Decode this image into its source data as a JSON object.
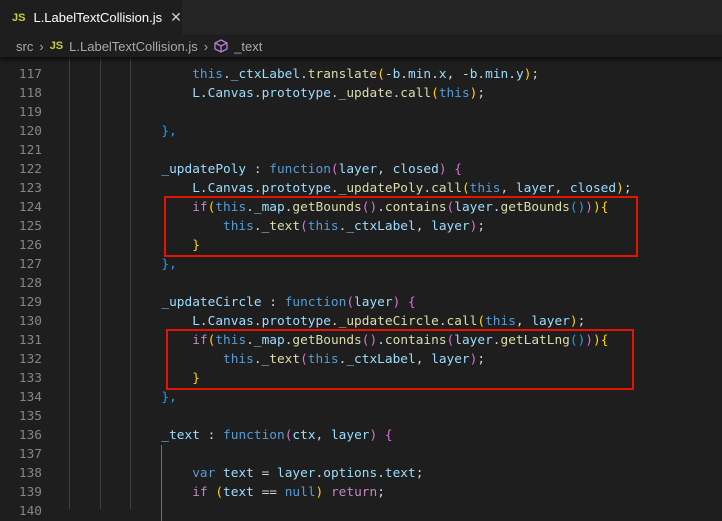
{
  "tab": {
    "icon": "JS",
    "title": "L.LabelTextCollision.js",
    "close": "✕"
  },
  "breadcrumb": {
    "folder": "src",
    "file_icon": "JS",
    "file": "L.LabelTextCollision.js",
    "symbol": "_text"
  },
  "lines": [
    {
      "n": "117",
      "indent": 16,
      "t": [
        [
          "this",
          "k"
        ],
        [
          ".",
          "p"
        ],
        [
          "_ctxLabel",
          "v"
        ],
        [
          ".",
          "p"
        ],
        [
          "translate",
          "f"
        ],
        [
          "(",
          "b1"
        ],
        [
          "-",
          "p"
        ],
        [
          "b",
          "v"
        ],
        [
          ".",
          "p"
        ],
        [
          "min",
          "v"
        ],
        [
          ".",
          "p"
        ],
        [
          "x",
          "v"
        ],
        [
          ", -",
          "p"
        ],
        [
          "b",
          "v"
        ],
        [
          ".",
          "p"
        ],
        [
          "min",
          "v"
        ],
        [
          ".",
          "p"
        ],
        [
          "y",
          "v"
        ],
        [
          ")",
          "b1"
        ],
        [
          ";",
          "p"
        ]
      ]
    },
    {
      "n": "118",
      "indent": 16,
      "t": [
        [
          "L",
          "v"
        ],
        [
          ".",
          "p"
        ],
        [
          "Canvas",
          "v"
        ],
        [
          ".",
          "p"
        ],
        [
          "prototype",
          "v"
        ],
        [
          ".",
          "p"
        ],
        [
          "_update",
          "f"
        ],
        [
          ".",
          "p"
        ],
        [
          "call",
          "f"
        ],
        [
          "(",
          "b1"
        ],
        [
          "this",
          "k"
        ],
        [
          ")",
          "b1"
        ],
        [
          ";",
          "p"
        ]
      ]
    },
    {
      "n": "119",
      "indent": 0,
      "t": []
    },
    {
      "n": "120",
      "indent": 12,
      "t": [
        [
          "},",
          "b3"
        ]
      ]
    },
    {
      "n": "121",
      "indent": 0,
      "t": []
    },
    {
      "n": "122",
      "indent": 12,
      "t": [
        [
          "_updatePoly",
          "v"
        ],
        [
          " : ",
          "p"
        ],
        [
          "function",
          "k"
        ],
        [
          "(",
          "b2"
        ],
        [
          "layer",
          "v"
        ],
        [
          ", ",
          "p"
        ],
        [
          "closed",
          "v"
        ],
        [
          ") ",
          "b2"
        ],
        [
          "{",
          "b2"
        ]
      ]
    },
    {
      "n": "123",
      "indent": 16,
      "t": [
        [
          "L",
          "v"
        ],
        [
          ".",
          "p"
        ],
        [
          "Canvas",
          "v"
        ],
        [
          ".",
          "p"
        ],
        [
          "prototype",
          "v"
        ],
        [
          ".",
          "p"
        ],
        [
          "_updatePoly",
          "f"
        ],
        [
          ".",
          "p"
        ],
        [
          "call",
          "f"
        ],
        [
          "(",
          "b1"
        ],
        [
          "this",
          "k"
        ],
        [
          ", ",
          "p"
        ],
        [
          "layer",
          "v"
        ],
        [
          ", ",
          "p"
        ],
        [
          "closed",
          "v"
        ],
        [
          ")",
          "b1"
        ],
        [
          ";",
          "p"
        ]
      ]
    },
    {
      "n": "124",
      "indent": 16,
      "t": [
        [
          "if",
          "c"
        ],
        [
          "(",
          "b1"
        ],
        [
          "this",
          "k"
        ],
        [
          ".",
          "p"
        ],
        [
          "_map",
          "v"
        ],
        [
          ".",
          "p"
        ],
        [
          "getBounds",
          "f"
        ],
        [
          "()",
          "b2"
        ],
        [
          ".",
          "p"
        ],
        [
          "contains",
          "f"
        ],
        [
          "(",
          "b2"
        ],
        [
          "layer",
          "v"
        ],
        [
          ".",
          "p"
        ],
        [
          "getBounds",
          "f"
        ],
        [
          "()",
          "b3"
        ],
        [
          ")",
          "b2"
        ],
        [
          ")",
          "b1"
        ],
        [
          "{",
          "b1"
        ]
      ]
    },
    {
      "n": "125",
      "indent": 20,
      "t": [
        [
          "this",
          "k"
        ],
        [
          ".",
          "p"
        ],
        [
          "_text",
          "f"
        ],
        [
          "(",
          "b2"
        ],
        [
          "this",
          "k"
        ],
        [
          ".",
          "p"
        ],
        [
          "_ctxLabel",
          "v"
        ],
        [
          ", ",
          "p"
        ],
        [
          "layer",
          "v"
        ],
        [
          ")",
          "b2"
        ],
        [
          ";",
          "p"
        ]
      ]
    },
    {
      "n": "126",
      "indent": 16,
      "t": [
        [
          "}",
          "b1"
        ]
      ]
    },
    {
      "n": "127",
      "indent": 12,
      "t": [
        [
          "},",
          "b3"
        ]
      ]
    },
    {
      "n": "128",
      "indent": 0,
      "t": []
    },
    {
      "n": "129",
      "indent": 12,
      "t": [
        [
          "_updateCircle",
          "v"
        ],
        [
          " : ",
          "p"
        ],
        [
          "function",
          "k"
        ],
        [
          "(",
          "b2"
        ],
        [
          "layer",
          "v"
        ],
        [
          ") ",
          "b2"
        ],
        [
          "{",
          "b2"
        ]
      ]
    },
    {
      "n": "130",
      "indent": 16,
      "t": [
        [
          "L",
          "v"
        ],
        [
          ".",
          "p"
        ],
        [
          "Canvas",
          "v"
        ],
        [
          ".",
          "p"
        ],
        [
          "prototype",
          "v"
        ],
        [
          ".",
          "p"
        ],
        [
          "_updateCircle",
          "f"
        ],
        [
          ".",
          "p"
        ],
        [
          "call",
          "f"
        ],
        [
          "(",
          "b1"
        ],
        [
          "this",
          "k"
        ],
        [
          ", ",
          "p"
        ],
        [
          "layer",
          "v"
        ],
        [
          ")",
          "b1"
        ],
        [
          ";",
          "p"
        ]
      ]
    },
    {
      "n": "131",
      "indent": 16,
      "t": [
        [
          "if",
          "c"
        ],
        [
          "(",
          "b1"
        ],
        [
          "this",
          "k"
        ],
        [
          ".",
          "p"
        ],
        [
          "_map",
          "v"
        ],
        [
          ".",
          "p"
        ],
        [
          "getBounds",
          "f"
        ],
        [
          "()",
          "b2"
        ],
        [
          ".",
          "p"
        ],
        [
          "contains",
          "f"
        ],
        [
          "(",
          "b2"
        ],
        [
          "layer",
          "v"
        ],
        [
          ".",
          "p"
        ],
        [
          "getLatLng",
          "f"
        ],
        [
          "()",
          "b3"
        ],
        [
          ")",
          "b2"
        ],
        [
          ")",
          "b1"
        ],
        [
          "{",
          "b1"
        ]
      ]
    },
    {
      "n": "132",
      "indent": 20,
      "t": [
        [
          "this",
          "k"
        ],
        [
          ".",
          "p"
        ],
        [
          "_text",
          "f"
        ],
        [
          "(",
          "b2"
        ],
        [
          "this",
          "k"
        ],
        [
          ".",
          "p"
        ],
        [
          "_ctxLabel",
          "v"
        ],
        [
          ", ",
          "p"
        ],
        [
          "layer",
          "v"
        ],
        [
          ")",
          "b2"
        ],
        [
          ";",
          "p"
        ]
      ]
    },
    {
      "n": "133",
      "indent": 16,
      "t": [
        [
          "}",
          "b1"
        ]
      ]
    },
    {
      "n": "134",
      "indent": 12,
      "t": [
        [
          "},",
          "b3"
        ]
      ]
    },
    {
      "n": "135",
      "indent": 0,
      "t": []
    },
    {
      "n": "136",
      "indent": 12,
      "t": [
        [
          "_text",
          "v"
        ],
        [
          " : ",
          "p"
        ],
        [
          "function",
          "k"
        ],
        [
          "(",
          "b2"
        ],
        [
          "ctx",
          "v"
        ],
        [
          ", ",
          "p"
        ],
        [
          "layer",
          "v"
        ],
        [
          ") ",
          "b2"
        ],
        [
          "{",
          "b2"
        ]
      ]
    },
    {
      "n": "137",
      "indent": 0,
      "t": []
    },
    {
      "n": "138",
      "indent": 16,
      "t": [
        [
          "var",
          "k"
        ],
        [
          " ",
          "p"
        ],
        [
          "text",
          "v"
        ],
        [
          " = ",
          "p"
        ],
        [
          "layer",
          "v"
        ],
        [
          ".",
          "p"
        ],
        [
          "options",
          "v"
        ],
        [
          ".",
          "p"
        ],
        [
          "text",
          "v"
        ],
        [
          ";",
          "p"
        ]
      ]
    },
    {
      "n": "139",
      "indent": 16,
      "t": [
        [
          "if",
          "c"
        ],
        [
          " ",
          "p"
        ],
        [
          "(",
          "b1"
        ],
        [
          "text",
          "v"
        ],
        [
          " == ",
          "p"
        ],
        [
          "null",
          "k"
        ],
        [
          ")",
          "b1"
        ],
        [
          " ",
          "p"
        ],
        [
          "return",
          "c"
        ],
        [
          ";",
          "p"
        ]
      ]
    },
    {
      "n": "140",
      "indent": 0,
      "t": []
    }
  ],
  "highlights": [
    {
      "from": "124",
      "to": "126",
      "color": "#e51400"
    },
    {
      "from": "131",
      "to": "133",
      "color": "#e51400"
    }
  ]
}
